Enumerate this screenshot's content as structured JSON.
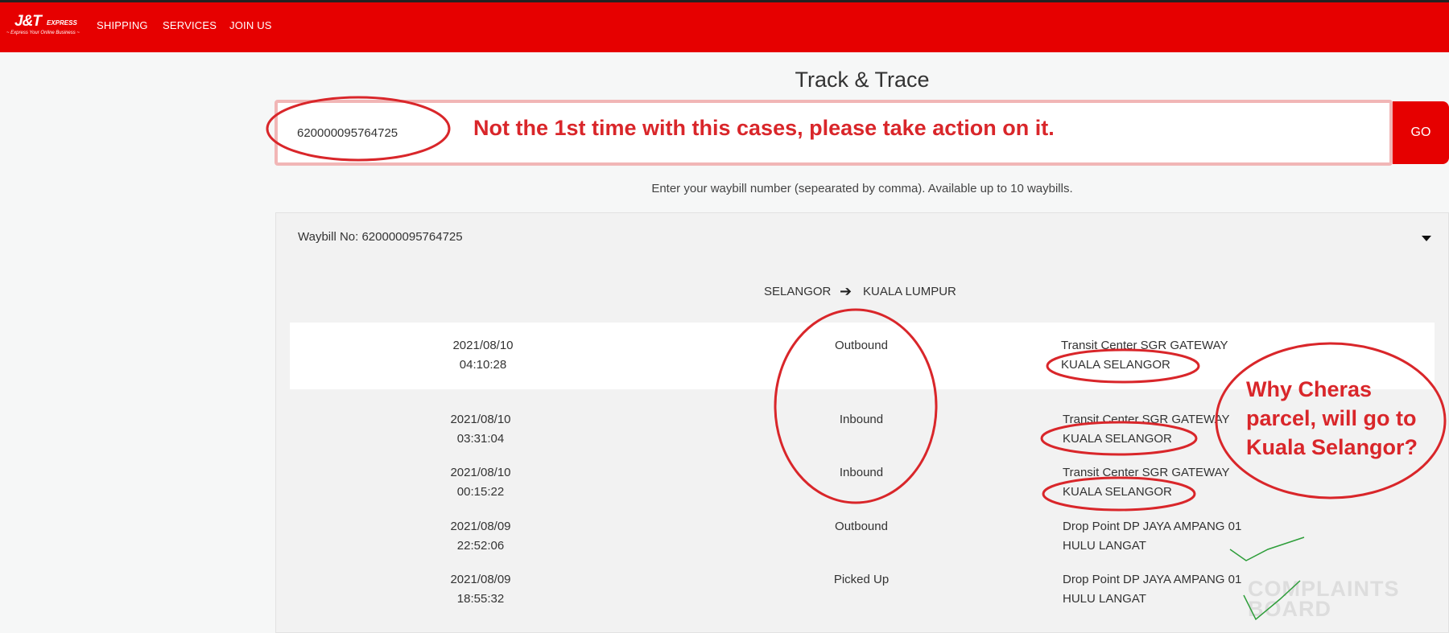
{
  "header": {
    "logo_main": "J&T",
    "logo_sub": "EXPRESS",
    "logo_tag": "~ Express Your Online Business ~",
    "nav": [
      "SHIPPING",
      "SERVICES",
      "JOIN US"
    ]
  },
  "page_title": "Track & Trace",
  "search": {
    "value": "620000095764725",
    "go_label": "GO"
  },
  "hint": "Enter your waybill number (sepearated by comma). Available up to 10 waybills.",
  "waybill_label": "Waybill No: 620000095764725",
  "route": {
    "from": "SELANGOR",
    "to": "KUALA LUMPUR"
  },
  "events": [
    {
      "date": "2021/08/10",
      "time": "04:10:28",
      "status": "Outbound",
      "location": "Transit Center SGR GATEWAY",
      "area": "KUALA SELANGOR"
    },
    {
      "date": "2021/08/10",
      "time": "03:31:04",
      "status": "Inbound",
      "location": "Transit Center SGR GATEWAY",
      "area": "KUALA SELANGOR"
    },
    {
      "date": "2021/08/10",
      "time": "00:15:22",
      "status": "Inbound",
      "location": "Transit Center SGR GATEWAY",
      "area": "KUALA SELANGOR"
    },
    {
      "date": "2021/08/09",
      "time": "22:52:06",
      "status": "Outbound",
      "location": "Drop Point DP JAYA AMPANG 01",
      "area": "HULU LANGAT"
    },
    {
      "date": "2021/08/09",
      "time": "18:55:32",
      "status": "Picked Up",
      "location": "Drop Point DP JAYA AMPANG 01",
      "area": "HULU LANGAT"
    }
  ],
  "annotations": {
    "top_note": "Not the 1st time with this cases, please take action on it.",
    "side_note": "Why Cheras parcel, will go to Kuala Selangor?",
    "color": "#d9262a"
  },
  "watermark": {
    "line1": "COMPLAINTS",
    "line2": "BOARD"
  },
  "colors": {
    "brand_red": "#e60000",
    "background": "#f6f7f7"
  }
}
